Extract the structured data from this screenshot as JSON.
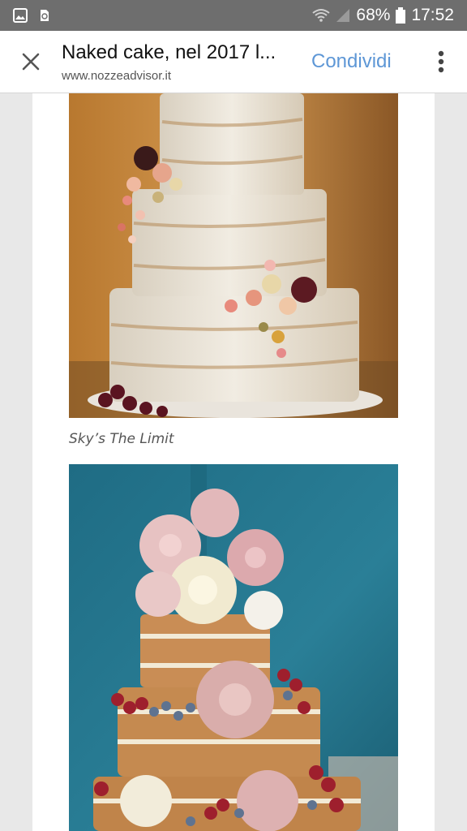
{
  "status_bar": {
    "battery_percent": "68%",
    "time": "17:52",
    "icons": [
      "image-icon",
      "recycle-app-icon",
      "wifi-icon",
      "signal-icon",
      "battery-icon"
    ]
  },
  "toolbar": {
    "title": "Naked cake, nel 2017 l...",
    "url": "www.nozzeadvisor.it",
    "share_label": "Condividi",
    "icons": [
      "close-icon",
      "more-vert-icon"
    ],
    "accent_color": "#5e97d6"
  },
  "article": {
    "images": [
      {
        "alt_subject": "naked-cake-three-tier-flowers"
      },
      {
        "alt_subject": "naked-cake-roses-berries"
      }
    ],
    "caption_1": "Sky’s The Limit"
  }
}
